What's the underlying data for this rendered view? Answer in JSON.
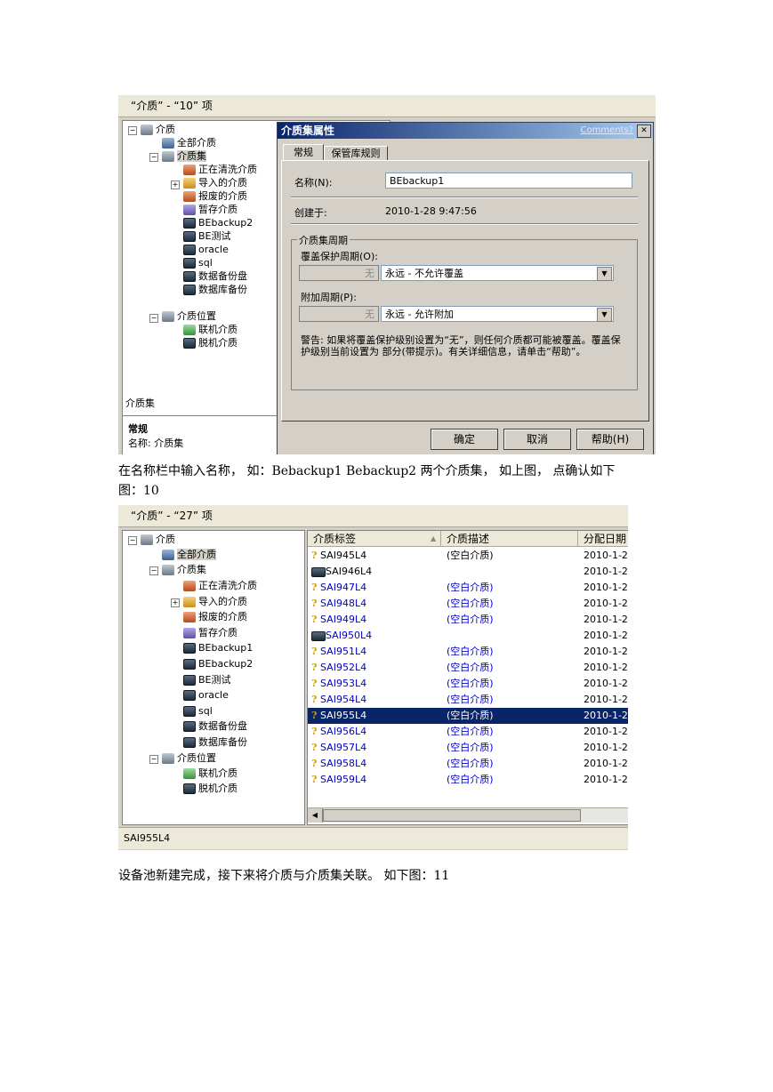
{
  "shot1": {
    "header": "“介质” - “10” 项",
    "tree": {
      "root": "介质",
      "all_media": "全部介质",
      "media_sets": "介质集",
      "children": [
        "正在清洗介质",
        "导入的介质",
        "报废的介质",
        "暂存介质",
        "BEbackup2",
        "BE测试",
        "oracle",
        "sql",
        "数据备份盘",
        "数据库备份"
      ],
      "location": "介质位置",
      "online": "联机介质",
      "offline": "脱机介质"
    },
    "bottom_label": "介质集",
    "props_title": "常规",
    "props_name": "名称: 介质集",
    "dialog": {
      "title": "介质集属性",
      "comments": "Comments?",
      "close": "✕",
      "tabs": [
        "常规",
        "保管库规则"
      ],
      "name_label": "名称(N):",
      "name_value": "BEbackup1",
      "created_label": "创建于:",
      "created_value": "2010-1-28 9:47:56",
      "group_label": "介质集周期",
      "overwrite_label": "覆盖保护周期(O):",
      "overwrite_num": "无",
      "overwrite_value": "永远 - 不允许覆盖",
      "append_label": "附加周期(P):",
      "append_num": "无",
      "append_value": "永远 - 允许附加",
      "warning": "警告: 如果将覆盖保护级别设置为“无”，则任何介质都可能被覆盖。覆盖保护级别当前设置为 部分(带提示)。有关详细信息，请单击“帮助”。",
      "ok": "确定",
      "cancel": "取消",
      "help": "帮助(H)"
    }
  },
  "text1": "在名称栏中输入名称， 如：Bebackup1 Bebackup2 两个介质集， 如上图， 点确认如下",
  "text1b": "图：10",
  "shot2": {
    "header": "“介质” - “27” 项",
    "tree": {
      "root": "介质",
      "all_media": "全部介质",
      "media_sets": "介质集",
      "children": [
        "正在清洗介质",
        "导入的介质",
        "报废的介质",
        "暂存介质",
        "BEbackup1",
        "BEbackup2",
        "BE测试",
        "oracle",
        "sql",
        "数据备份盘",
        "数据库备份"
      ],
      "location": "介质位置",
      "online": "联机介质",
      "offline": "脱机介质"
    },
    "columns": [
      "介质标签",
      "介质描述",
      "分配日期"
    ],
    "rows": [
      {
        "label": "SAI945L4",
        "desc": "(空白介质)",
        "date": "2010-1-2",
        "icon": "q",
        "blue": false
      },
      {
        "label": "SAI946L4",
        "desc": "",
        "date": "2010-1-2",
        "icon": "tape",
        "blue": false
      },
      {
        "label": "SAI947L4",
        "desc": "(空白介质)",
        "date": "2010-1-2",
        "icon": "q",
        "blue": true
      },
      {
        "label": "SAI948L4",
        "desc": "(空白介质)",
        "date": "2010-1-2",
        "icon": "q",
        "blue": true
      },
      {
        "label": "SAI949L4",
        "desc": "(空白介质)",
        "date": "2010-1-2",
        "icon": "q",
        "blue": true
      },
      {
        "label": "SAI950L4",
        "desc": "",
        "date": "2010-1-2",
        "icon": "tape",
        "blue": true
      },
      {
        "label": "SAI951L4",
        "desc": "(空白介质)",
        "date": "2010-1-2",
        "icon": "q",
        "blue": true
      },
      {
        "label": "SAI952L4",
        "desc": "(空白介质)",
        "date": "2010-1-2",
        "icon": "q",
        "blue": true
      },
      {
        "label": "SAI953L4",
        "desc": "(空白介质)",
        "date": "2010-1-2",
        "icon": "q",
        "blue": true
      },
      {
        "label": "SAI954L4",
        "desc": "(空白介质)",
        "date": "2010-1-2",
        "icon": "q",
        "blue": true
      },
      {
        "label": "SAI955L4",
        "desc": "(空白介质)",
        "date": "2010-1-2",
        "icon": "q",
        "blue": false,
        "selected": true
      },
      {
        "label": "SAI956L4",
        "desc": "(空白介质)",
        "date": "2010-1-2",
        "icon": "q",
        "blue": true
      },
      {
        "label": "SAI957L4",
        "desc": "(空白介质)",
        "date": "2010-1-2",
        "icon": "q",
        "blue": true
      },
      {
        "label": "SAI958L4",
        "desc": "(空白介质)",
        "date": "2010-1-2",
        "icon": "q",
        "blue": true
      },
      {
        "label": "SAI959L4",
        "desc": "(空白介质)",
        "date": "2010-1-2",
        "icon": "q",
        "blue": true
      }
    ],
    "status": "SAI955L4"
  },
  "text2": "设备池新建完成，接下来将介质与介质集关联。 如下图：11"
}
